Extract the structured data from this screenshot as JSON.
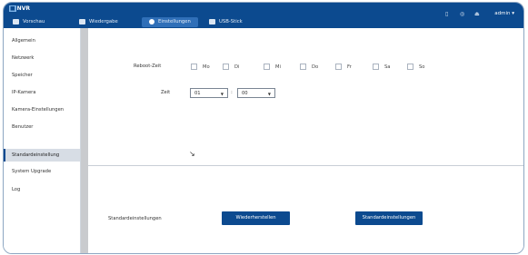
{
  "header": {
    "logo": "NVR",
    "nav": [
      {
        "label": "Vorschau",
        "icon": "preview-icon"
      },
      {
        "label": "Wiedergabe",
        "icon": "playback-icon"
      },
      {
        "label": "Einstellungen",
        "icon": "settings-icon"
      },
      {
        "label": "USB-Stick",
        "icon": "usb-icon"
      }
    ],
    "user": "admin ▾"
  },
  "sidebar": {
    "items": [
      {
        "label": "Allgemein"
      },
      {
        "label": "Netzwerk"
      },
      {
        "label": "Speicher"
      },
      {
        "label": "IP-Kamera"
      },
      {
        "label": "Kamera-Einstellungen"
      },
      {
        "label": "Benutzer"
      },
      {
        "label": "Standardeinstellung",
        "active": true
      },
      {
        "label": "System Upgrade"
      },
      {
        "label": "Log"
      }
    ]
  },
  "main": {
    "reboot_label": "Reboot-Zeit",
    "days": [
      "Mo",
      "Di",
      "Mi",
      "Do",
      "Fr",
      "Sa",
      "So"
    ],
    "time_label": "Zeit",
    "hour": "01",
    "minute": "00",
    "defaults_label": "Standardeinstellungen",
    "restore_button": "Wiederherstellen",
    "defaults_button": "Standardeinstellungen"
  },
  "colors": {
    "accent": "#0c4a8f",
    "topbar": "#0c4a8f",
    "active_tab": "#2f6fb8"
  }
}
